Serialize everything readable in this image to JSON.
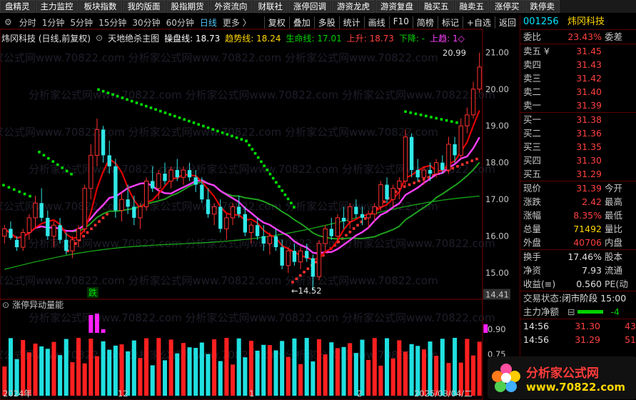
{
  "top_menu": [
    "盘精灵",
    "主力监控",
    "板块指数",
    "我的版面",
    "股指期货",
    "外资流向",
    "财联社",
    "涨停回调",
    "游资龙虎",
    "游资复盘",
    "融买五",
    "融卖五",
    "涨停买",
    "跌停卖"
  ],
  "periods": [
    "分时",
    "1分钟",
    "5分钟",
    "15分钟",
    "30分钟",
    "60分钟",
    "日线",
    "更多 〉"
  ],
  "active_period": "日线",
  "tools": [
    "复权",
    "叠加",
    "多股",
    "统计",
    "画线",
    "F10",
    "简榜",
    "标记",
    "+自选",
    "返回"
  ],
  "chart_title": {
    "stock": "炜冈科技 (日线,前复权)",
    "indicator": "天地绝杀主图",
    "lines": [
      {
        "label": "操盘线: 18.73",
        "color": "#ffffff"
      },
      {
        "label": "趋势线: 18.24",
        "color": "#ffd700"
      },
      {
        "label": "生命线: 17.01",
        "color": "#00d000"
      },
      {
        "label": "上升: 18.73",
        "color": "#ff4040"
      },
      {
        "label": "下降: -",
        "color": "#00d000"
      },
      {
        "label": "上趋: 1◇",
        "color": "#ff40ff"
      }
    ]
  },
  "price_axis": [
    "21.00",
    "20.00",
    "19.00",
    "18.00",
    "17.00",
    "16.00",
    "15.00"
  ],
  "price_axis_current": "14.41",
  "annotations": {
    "high": "20.99",
    "low": "14.52",
    "die": "跌"
  },
  "lower_title": "涨停异动量能",
  "lower_axis": [
    "0.90",
    "0.75"
  ],
  "date_axis": [
    "2024年",
    "12",
    "1",
    "2",
    "2025/03/04/二"
  ],
  "watermark": "分析家公式网www.70822.com",
  "logo": {
    "line1": "分析家公式网",
    "line2": "www.70822.com"
  },
  "quote": {
    "code": "001256",
    "name": "炜冈科技",
    "weibi_label": "委比",
    "weibi": "23.43%",
    "weicha_label": "委差",
    "asks": [
      {
        "label": "卖五 ¥",
        "price": "31.45"
      },
      {
        "label": "卖四",
        "price": "31.43"
      },
      {
        "label": "卖三",
        "price": "31.42"
      },
      {
        "label": "卖二",
        "price": "31.40"
      },
      {
        "label": "卖一",
        "price": "31.39"
      }
    ],
    "bids": [
      {
        "label": "买一",
        "price": "31.38"
      },
      {
        "label": "买二",
        "price": "31.36"
      },
      {
        "label": "买三",
        "price": "31.35"
      },
      {
        "label": "买四",
        "price": "31.30"
      },
      {
        "label": "买五",
        "price": "31.29"
      }
    ],
    "stats": [
      {
        "l": "现价",
        "v": "31.39",
        "vc": "red",
        "r": "今开"
      },
      {
        "l": "涨跌",
        "v": "2.42",
        "vc": "red",
        "r": "最高"
      },
      {
        "l": "涨幅",
        "v": "8.35%",
        "vc": "red",
        "r": "最低"
      },
      {
        "l": "总量",
        "v": "71492",
        "vc": "yellow",
        "r": "量比"
      },
      {
        "l": "外盘",
        "v": "40706",
        "vc": "red",
        "r": "内盘"
      }
    ],
    "stats2": [
      {
        "l": "换手",
        "v": "17.46%",
        "vc": "white",
        "r": "股本"
      },
      {
        "l": "净资",
        "v": "7.93",
        "vc": "white",
        "r": "流通"
      },
      {
        "l": "收益(≡)",
        "v": "0.560",
        "vc": "white",
        "r": "PE(动"
      }
    ],
    "trade_status_label": "交易状态:",
    "trade_status": "闭市阶段 15:00",
    "main_flow_label": "主力净额",
    "main_flow_value": "-4",
    "ticks": [
      {
        "time": "14:56",
        "price": "31.30",
        "vol": "43"
      },
      {
        "time": "14:56",
        "price": "31.29",
        "vol": "51"
      }
    ]
  },
  "chart_data": {
    "type": "line",
    "ylim": [
      14.4,
      21.2
    ],
    "candles": [
      [
        16.0,
        16.3,
        15.8,
        16.2
      ],
      [
        16.2,
        16.4,
        15.9,
        15.95
      ],
      [
        15.9,
        16.0,
        15.6,
        15.7
      ],
      [
        15.7,
        16.2,
        15.6,
        16.1
      ],
      [
        16.1,
        16.6,
        15.9,
        16.5
      ],
      [
        16.5,
        17.1,
        16.2,
        16.9
      ],
      [
        16.9,
        17.3,
        16.4,
        16.5
      ],
      [
        16.5,
        16.7,
        15.9,
        16.0
      ],
      [
        16.0,
        16.4,
        15.7,
        16.3
      ],
      [
        16.3,
        16.5,
        15.8,
        15.9
      ],
      [
        15.9,
        16.1,
        15.5,
        15.6
      ],
      [
        15.6,
        16.0,
        15.4,
        15.9
      ],
      [
        15.9,
        16.3,
        15.7,
        16.2
      ],
      [
        16.2,
        17.4,
        16.1,
        17.3
      ],
      [
        17.3,
        18.5,
        17.0,
        18.2
      ],
      [
        18.2,
        19.2,
        17.9,
        18.9
      ],
      [
        18.9,
        19.0,
        18.0,
        18.2
      ],
      [
        18.2,
        18.6,
        17.7,
        17.9
      ],
      [
        17.9,
        18.1,
        16.5,
        16.7
      ],
      [
        16.7,
        17.2,
        16.4,
        17.0
      ],
      [
        17.0,
        17.4,
        16.6,
        16.8
      ],
      [
        16.8,
        17.1,
        16.3,
        16.5
      ],
      [
        16.5,
        16.9,
        16.2,
        16.8
      ],
      [
        16.8,
        17.6,
        16.7,
        17.5
      ],
      [
        17.5,
        17.9,
        17.2,
        17.3
      ],
      [
        17.3,
        17.8,
        17.0,
        17.7
      ],
      [
        17.7,
        18.0,
        17.4,
        17.5
      ],
      [
        17.5,
        17.9,
        17.3,
        17.8
      ],
      [
        17.8,
        18.1,
        17.5,
        17.6
      ],
      [
        17.6,
        17.9,
        17.4,
        17.8
      ],
      [
        17.8,
        18.0,
        17.5,
        17.6
      ],
      [
        17.6,
        17.8,
        17.2,
        17.4
      ],
      [
        17.4,
        17.6,
        16.9,
        17.0
      ],
      [
        17.0,
        17.3,
        16.5,
        16.6
      ],
      [
        16.6,
        16.9,
        16.3,
        16.8
      ],
      [
        16.8,
        17.0,
        16.1,
        16.2
      ],
      [
        16.2,
        16.6,
        15.9,
        16.5
      ],
      [
        16.5,
        16.9,
        16.3,
        16.8
      ],
      [
        16.8,
        17.1,
        16.5,
        16.6
      ],
      [
        16.6,
        16.8,
        16.0,
        16.1
      ],
      [
        16.1,
        16.4,
        15.8,
        16.3
      ],
      [
        16.3,
        16.5,
        15.9,
        16.0
      ],
      [
        16.0,
        16.3,
        15.6,
        15.8
      ],
      [
        15.8,
        16.1,
        15.5,
        16.0
      ],
      [
        16.0,
        16.2,
        15.6,
        15.7
      ],
      [
        15.7,
        15.9,
        15.1,
        15.2
      ],
      [
        15.2,
        15.7,
        15.0,
        15.6
      ],
      [
        15.6,
        15.8,
        15.2,
        15.3
      ],
      [
        15.3,
        15.7,
        15.1,
        15.6
      ],
      [
        15.6,
        15.8,
        15.3,
        15.4
      ],
      [
        15.4,
        15.5,
        14.52,
        14.9
      ],
      [
        14.9,
        15.9,
        14.8,
        15.8
      ],
      [
        15.8,
        16.3,
        15.6,
        16.2
      ],
      [
        16.2,
        16.5,
        15.9,
        16.0
      ],
      [
        16.0,
        16.6,
        15.8,
        16.5
      ],
      [
        16.5,
        16.8,
        16.2,
        16.4
      ],
      [
        16.4,
        16.9,
        16.2,
        16.8
      ],
      [
        16.8,
        17.0,
        16.5,
        16.6
      ],
      [
        16.6,
        16.8,
        16.3,
        16.5
      ],
      [
        16.5,
        16.7,
        16.2,
        16.6
      ],
      [
        16.6,
        16.9,
        16.4,
        16.8
      ],
      [
        16.8,
        17.5,
        16.7,
        17.4
      ],
      [
        17.4,
        17.6,
        16.9,
        17.0
      ],
      [
        17.0,
        17.4,
        16.8,
        17.3
      ],
      [
        17.3,
        17.6,
        17.0,
        17.5
      ],
      [
        17.5,
        18.9,
        17.4,
        18.7
      ],
      [
        18.7,
        18.8,
        17.6,
        17.8
      ],
      [
        17.8,
        18.1,
        17.5,
        17.6
      ],
      [
        17.6,
        17.9,
        17.4,
        17.8
      ],
      [
        17.8,
        18.0,
        17.5,
        17.7
      ],
      [
        17.7,
        18.1,
        17.6,
        18.0
      ],
      [
        18.0,
        18.2,
        17.7,
        17.8
      ],
      [
        17.8,
        18.7,
        17.7,
        18.5
      ],
      [
        18.5,
        18.7,
        18.0,
        18.2
      ],
      [
        18.2,
        19.2,
        18.1,
        19.0
      ],
      [
        19.0,
        19.5,
        18.8,
        19.3
      ],
      [
        19.3,
        20.2,
        19.2,
        20.0
      ],
      [
        20.0,
        20.99,
        19.9,
        20.6
      ]
    ],
    "series": [
      {
        "name": "操盘线",
        "values": [
          16.3,
          16.45,
          16.5
        ]
      },
      {
        "name": "趋势线",
        "values": [
          16.2,
          16.3,
          16.4
        ]
      },
      {
        "name": "生命线",
        "values": [
          15.0,
          15.2,
          15.4
        ]
      }
    ]
  }
}
